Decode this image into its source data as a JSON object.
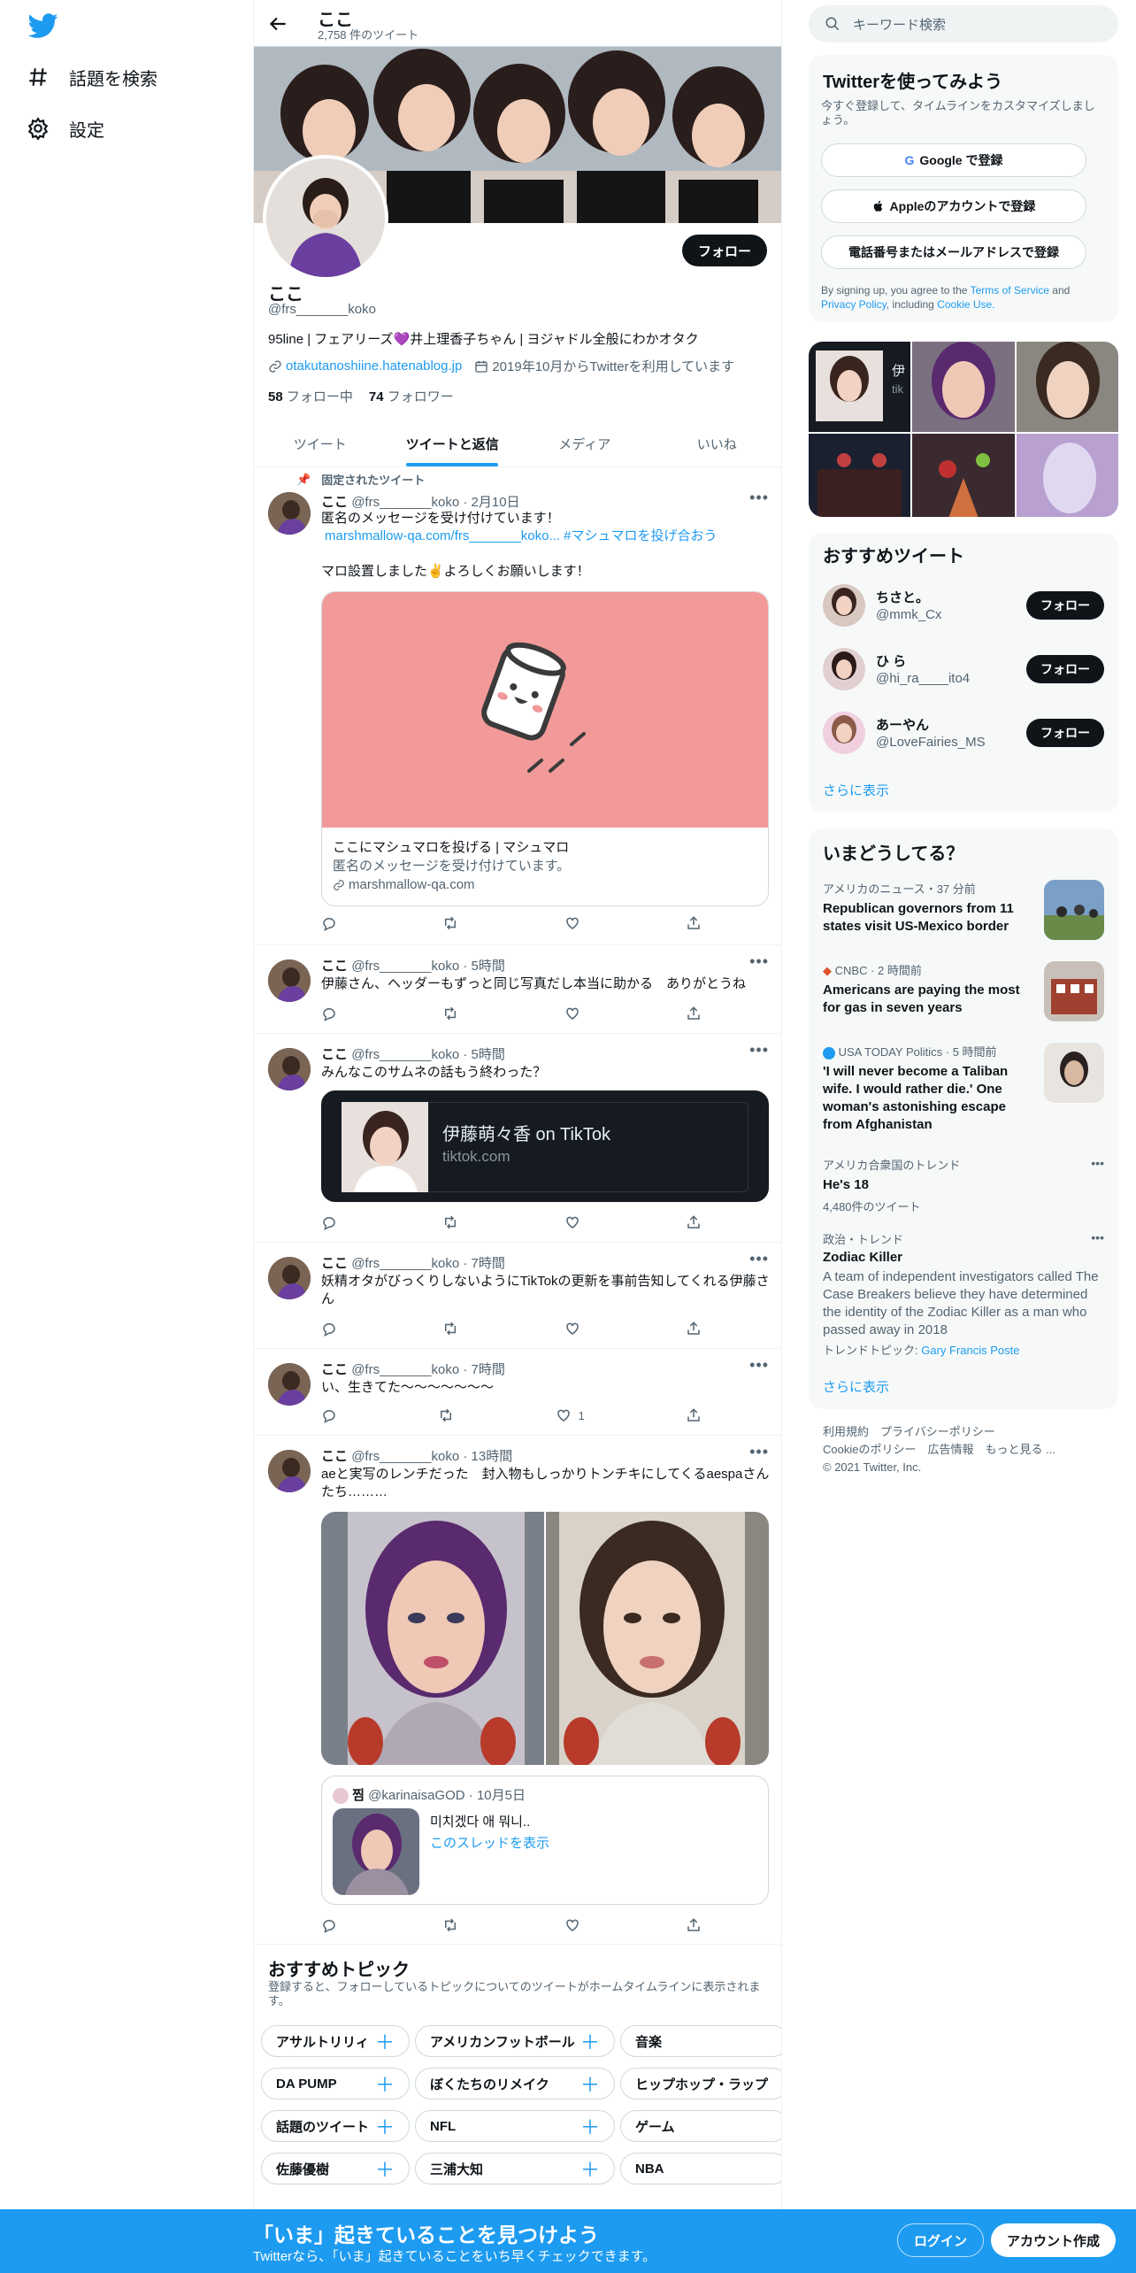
{
  "nav": {
    "explore": "話題を検索",
    "settings": "設定"
  },
  "profile": {
    "name": "ここ",
    "tweet_count": "2,758 件のツイート",
    "handle": "@frs_______koko",
    "bio": "95line | フェアリーズ💜井上理香子ちゃん | ヨジャドル全般にわかオタク",
    "link": "otakutanoshiine.hatenablog.jp",
    "joined": "2019年10月からTwitterを利用しています",
    "following_count": "58",
    "following_label": "フォロー中",
    "followers_count": "74",
    "followers_label": "フォロワー",
    "follow_button": "フォロー"
  },
  "tabs": [
    "ツイート",
    "ツイートと返信",
    "メディア",
    "いいね"
  ],
  "tweets": {
    "pinned_label": "固定されたツイート",
    "t1": {
      "name": "ここ",
      "handle": "@frs_______koko",
      "time": "2月10日",
      "line1": "匿名のメッセージを受け付けています！",
      "link": "marshmallow-qa.com/frs_______koko...",
      "hashtag": "#マシュマロを投げ合おう",
      "line2": "マロ設置しました✌️よろしくお願いします！",
      "card_title": "ここにマシュマロを投げる | マシュマロ",
      "card_desc": "匿名のメッセージを受け付けています。",
      "card_domain": "marshmallow-qa.com"
    },
    "t2": {
      "name": "ここ",
      "handle": "@frs_______koko",
      "time": "5時間",
      "text": "伊藤さん、ヘッダーもずっと同じ写真だし本当に助かる　ありがとうね"
    },
    "t3": {
      "name": "ここ",
      "handle": "@frs_______koko",
      "time": "5時間",
      "text": "みんなこのサムネの話もう終わった？",
      "card_title": "伊藤萌々香 on TikTok",
      "card_domain": "tiktok.com"
    },
    "t4": {
      "name": "ここ",
      "handle": "@frs_______koko",
      "time": "7時間",
      "text": "妖精オタがびっくりしないようにTikTokの更新を事前告知してくれる伊藤さん"
    },
    "t5": {
      "name": "ここ",
      "handle": "@frs_______koko",
      "time": "7時間",
      "text": "い、生きてた〜〜〜〜〜〜〜",
      "likes": "1"
    },
    "t6": {
      "name": "ここ",
      "handle": "@frs_______koko",
      "time": "13時間",
      "text": "aeと実写のレンチだった　封入物もしっかりトンチキにしてくるaespaさんたち………",
      "quote_name": "찜",
      "quote_handle": "@karinaisaGOD",
      "quote_time": "10月5日",
      "quote_text": "미치겠다 애 뭐니..",
      "quote_link": "このスレッドを表示"
    }
  },
  "topics": {
    "title": "おすすめトピック",
    "desc": "登録すると、フォローしているトピックについてのツイートがホームタイムラインに表示されます。",
    "items": [
      "アサルトリリィ",
      "アメリカンフットボール",
      "音楽",
      "DA PUMP",
      "ぼくたちのリメイク",
      "ヒップホップ・ラップ",
      "話題のツイート",
      "NFL",
      "ゲーム",
      "佐藤優樹",
      "三浦大知",
      "NBA"
    ]
  },
  "right": {
    "search_placeholder": "キーワード検索",
    "signup": {
      "title": "Twitterを使ってみよう",
      "desc": "今すぐ登録して、タイムラインをカスタマイズしましょう。",
      "google": "Google で登録",
      "apple": "Appleのアカウントで登録",
      "phone": "電話番号またはメールアドレスで登録",
      "legal_1": "By signing up, you agree to the",
      "terms": "Terms of Service",
      "legal_2": "and",
      "privacy": "Privacy Policy",
      "legal_3": ", including",
      "cookie": "Cookie Use."
    },
    "media_label": "伊",
    "media_sub": "tik",
    "who": {
      "title": "おすすめツイート",
      "users": [
        {
          "name": "ちさと。",
          "handle": "@mmk_Cx"
        },
        {
          "name": "ひ ら",
          "handle": "@hi_ra____ito4"
        },
        {
          "name": "あーやん",
          "handle": "@LoveFairies_MS"
        }
      ],
      "follow": "フォロー",
      "more": "さらに表示"
    },
    "trends": {
      "title": "いまどうしてる？",
      "items": [
        {
          "meta": "アメリカのニュース・37 分前",
          "title": "Republican governors from 11 states visit US-Mexico border"
        },
        {
          "meta": "CNBC · 2 時間前",
          "title": "Americans are paying the most for gas in seven years"
        },
        {
          "meta": "USA TODAY Politics · 5 時間前",
          "title": "'I will never become a Taliban wife. I would rather die.' One woman's astonishing escape from Afghanistan"
        },
        {
          "meta": "アメリカ合衆国のトレンド",
          "title": "He's 18",
          "count": "4,480件のツイート"
        },
        {
          "meta": "政治・トレンド",
          "title": "Zodiac Killer",
          "desc": "A team of independent investigators called The Case Breakers believe they have determined the identity of the Zodiac Killer as a man who passed away in 2018",
          "topic_label": "トレンドトピック:",
          "topic": "Gary Francis Poste"
        }
      ],
      "more": "さらに表示"
    },
    "footer": {
      "terms": "利用規約",
      "privacy": "プライバシーポリシー",
      "cookie": "Cookieのポリシー",
      "ads": "広告情報",
      "more": "もっと見る ...",
      "copyright": "© 2021 Twitter, Inc."
    }
  },
  "bottom": {
    "title": "「いま」起きていることを見つけよう",
    "subtitle": "Twitterなら、「いま」起きていることをいち早くチェックできます。",
    "login": "ログイン",
    "signup": "アカウント作成"
  },
  "colors": {
    "accent": "#1d9bf0",
    "marshmallow_bg": "#f29a9a",
    "tiktok_bg": "#161b22"
  }
}
